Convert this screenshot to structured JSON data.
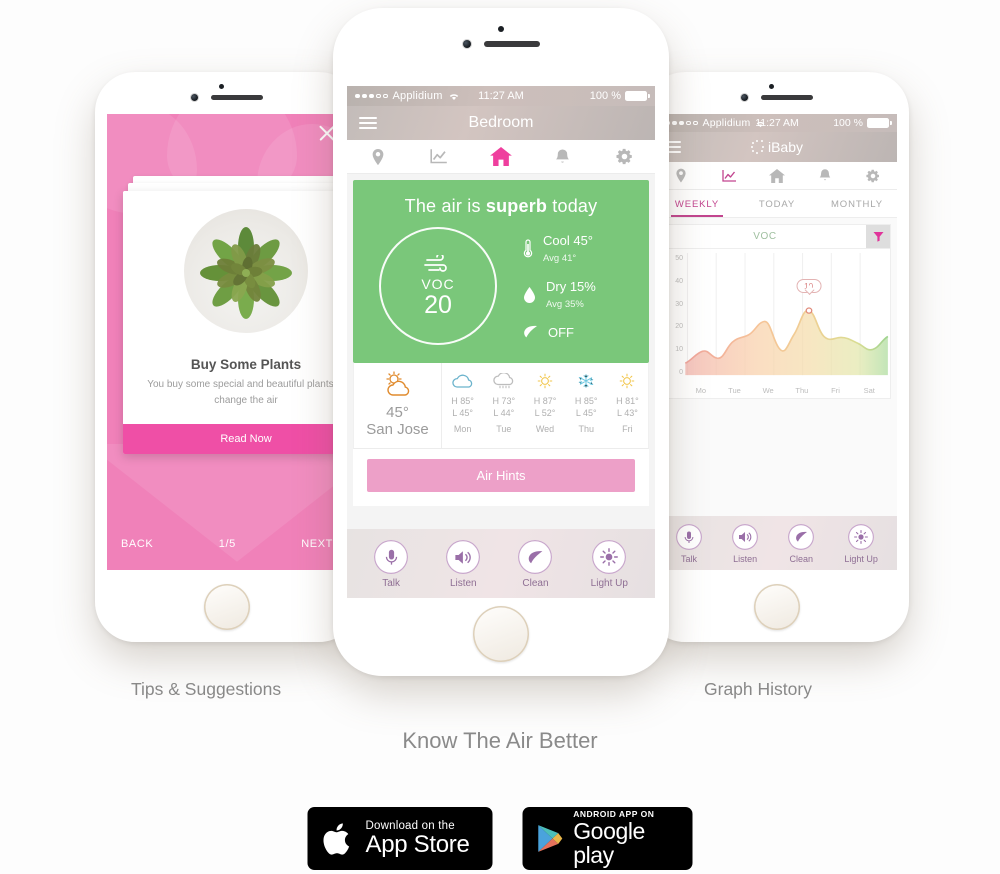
{
  "page": {
    "background": "#fdfdfd",
    "captions": {
      "left": "Tips & Suggestions",
      "center": "Know The Air Better",
      "right": "Graph History"
    }
  },
  "status_bar": {
    "carrier": "Applidium",
    "time": "11:27 AM",
    "battery": "100 %",
    "signal_dots_filled": 3,
    "signal_dots_total": 5,
    "wifi_icon": "wifi-icon",
    "battery_icon": "battery-full-icon"
  },
  "tab_bar": {
    "items": [
      {
        "name": "location",
        "icon": "location-pin-icon",
        "active": false
      },
      {
        "name": "graph",
        "icon": "line-chart-icon",
        "active": false
      },
      {
        "name": "home",
        "icon": "home-icon",
        "active": true
      },
      {
        "name": "alerts",
        "icon": "bell-icon",
        "active": false
      },
      {
        "name": "settings",
        "icon": "gear-icon",
        "active": false
      }
    ],
    "active_color": "#ef3f9e",
    "inactive_color": "#b8b8b8"
  },
  "center_phone": {
    "title": "Bedroom",
    "menu_icon": "hamburger-menu-icon",
    "air_card": {
      "headline_prefix": "The air is ",
      "headline_strong": "superb",
      "headline_suffix": " today",
      "background": "#7ac77a",
      "gauge": {
        "icon": "wind-icon",
        "label": "VOC",
        "value": "20"
      },
      "stats": [
        {
          "icon": "thermometer-icon",
          "main": "Cool 45°",
          "sub": "Avg 41°"
        },
        {
          "icon": "water-drop-icon",
          "main": "Dry 15%",
          "sub": "Avg 35%"
        },
        {
          "icon": "leaf-icon",
          "main": "OFF",
          "sub": ""
        }
      ]
    },
    "weather": {
      "city": "San Jose",
      "city_temp": "45°",
      "city_icon": "sun-behind-cloud-icon",
      "days": [
        {
          "day": "Mon",
          "icon": "cloud-icon",
          "high": "H 85°",
          "low": "L 45°"
        },
        {
          "day": "Tue",
          "icon": "rain-cloud-icon",
          "high": "H 73°",
          "low": "L 44°"
        },
        {
          "day": "Wed",
          "icon": "sun-icon",
          "high": "H 87°",
          "low": "L 52°"
        },
        {
          "day": "Thu",
          "icon": "snowflake-icon",
          "high": "H 85°",
          "low": "L 45°"
        },
        {
          "day": "Fri",
          "icon": "sun-icon",
          "high": "H 81°",
          "low": "L 43°"
        }
      ]
    },
    "air_hints_button": "Air Hints",
    "actions": [
      {
        "label": "Talk",
        "icon": "microphone-icon"
      },
      {
        "label": "Listen",
        "icon": "speaker-icon"
      },
      {
        "label": "Clean",
        "icon": "leaf-icon"
      },
      {
        "label": "Light Up",
        "icon": "brightness-icon"
      }
    ]
  },
  "left_phone": {
    "close_icon": "close-x-icon",
    "card": {
      "photo_icon": "succulent-plant-photo",
      "title": "Buy Some Plants",
      "description": "You buy some special and beautiful plants to change the air",
      "cta": "Read Now"
    },
    "nav": {
      "back": "BACK",
      "counter": "1/5",
      "next": "NEXT"
    },
    "background": "#f081b9",
    "cta_color": "#ef4fa6"
  },
  "right_phone": {
    "title": "iBaby",
    "menu_icon": "hamburger-menu-icon",
    "segments": [
      {
        "label": "WEEKLY",
        "active": true
      },
      {
        "label": "TODAY",
        "active": false
      },
      {
        "label": "MONTHLY",
        "active": false
      }
    ],
    "chart_header": {
      "label": "VOC",
      "filter_icon": "filter-funnel-icon"
    },
    "actions": [
      {
        "label": "Talk",
        "icon": "microphone-icon"
      },
      {
        "label": "Listen",
        "icon": "speaker-icon"
      },
      {
        "label": "Clean",
        "icon": "leaf-icon"
      },
      {
        "label": "Light Up",
        "icon": "brightness-icon"
      }
    ]
  },
  "chart_data": {
    "type": "area",
    "title": "VOC",
    "xlabel": "",
    "ylabel": "",
    "ylim": [
      0,
      50
    ],
    "yticks": [
      0,
      10,
      20,
      30,
      40,
      50
    ],
    "grid": true,
    "legend": "none",
    "categories": [
      "Mo",
      "Tue",
      "We",
      "Thu",
      "Fri",
      "Sat"
    ],
    "tooltip": {
      "value": "10",
      "x_index": 13
    },
    "x": [
      0,
      1,
      2,
      3,
      4,
      5,
      6,
      7,
      8,
      9,
      10,
      11,
      12,
      13,
      14,
      15,
      16,
      17,
      18,
      19,
      20,
      21,
      22,
      23
    ],
    "values": [
      5,
      7,
      9,
      9,
      6,
      6,
      9,
      14,
      15,
      18,
      19.5,
      15,
      11,
      13,
      22,
      18,
      14,
      14,
      14.5,
      14,
      12,
      10,
      9.5,
      11,
      13,
      12
    ],
    "series": [
      {
        "name": "VOC",
        "values": [
          5,
          7,
          9,
          9,
          6,
          6,
          9,
          14,
          15,
          18,
          19.5,
          15,
          11,
          13,
          22,
          18,
          14,
          14,
          14.5,
          14,
          12,
          10,
          9.5,
          11,
          13,
          12
        ]
      }
    ],
    "area_gradient": [
      "#f2a8a0",
      "#f5c89a",
      "#e8d08a",
      "#a8d89a"
    ]
  },
  "store_badges": {
    "apple": {
      "icon": "apple-logo-icon",
      "small": "Download on the",
      "big": "App Store"
    },
    "google": {
      "icon": "google-play-triangle-icon",
      "small": "ANDROID APP ON",
      "big": "Google play"
    }
  }
}
